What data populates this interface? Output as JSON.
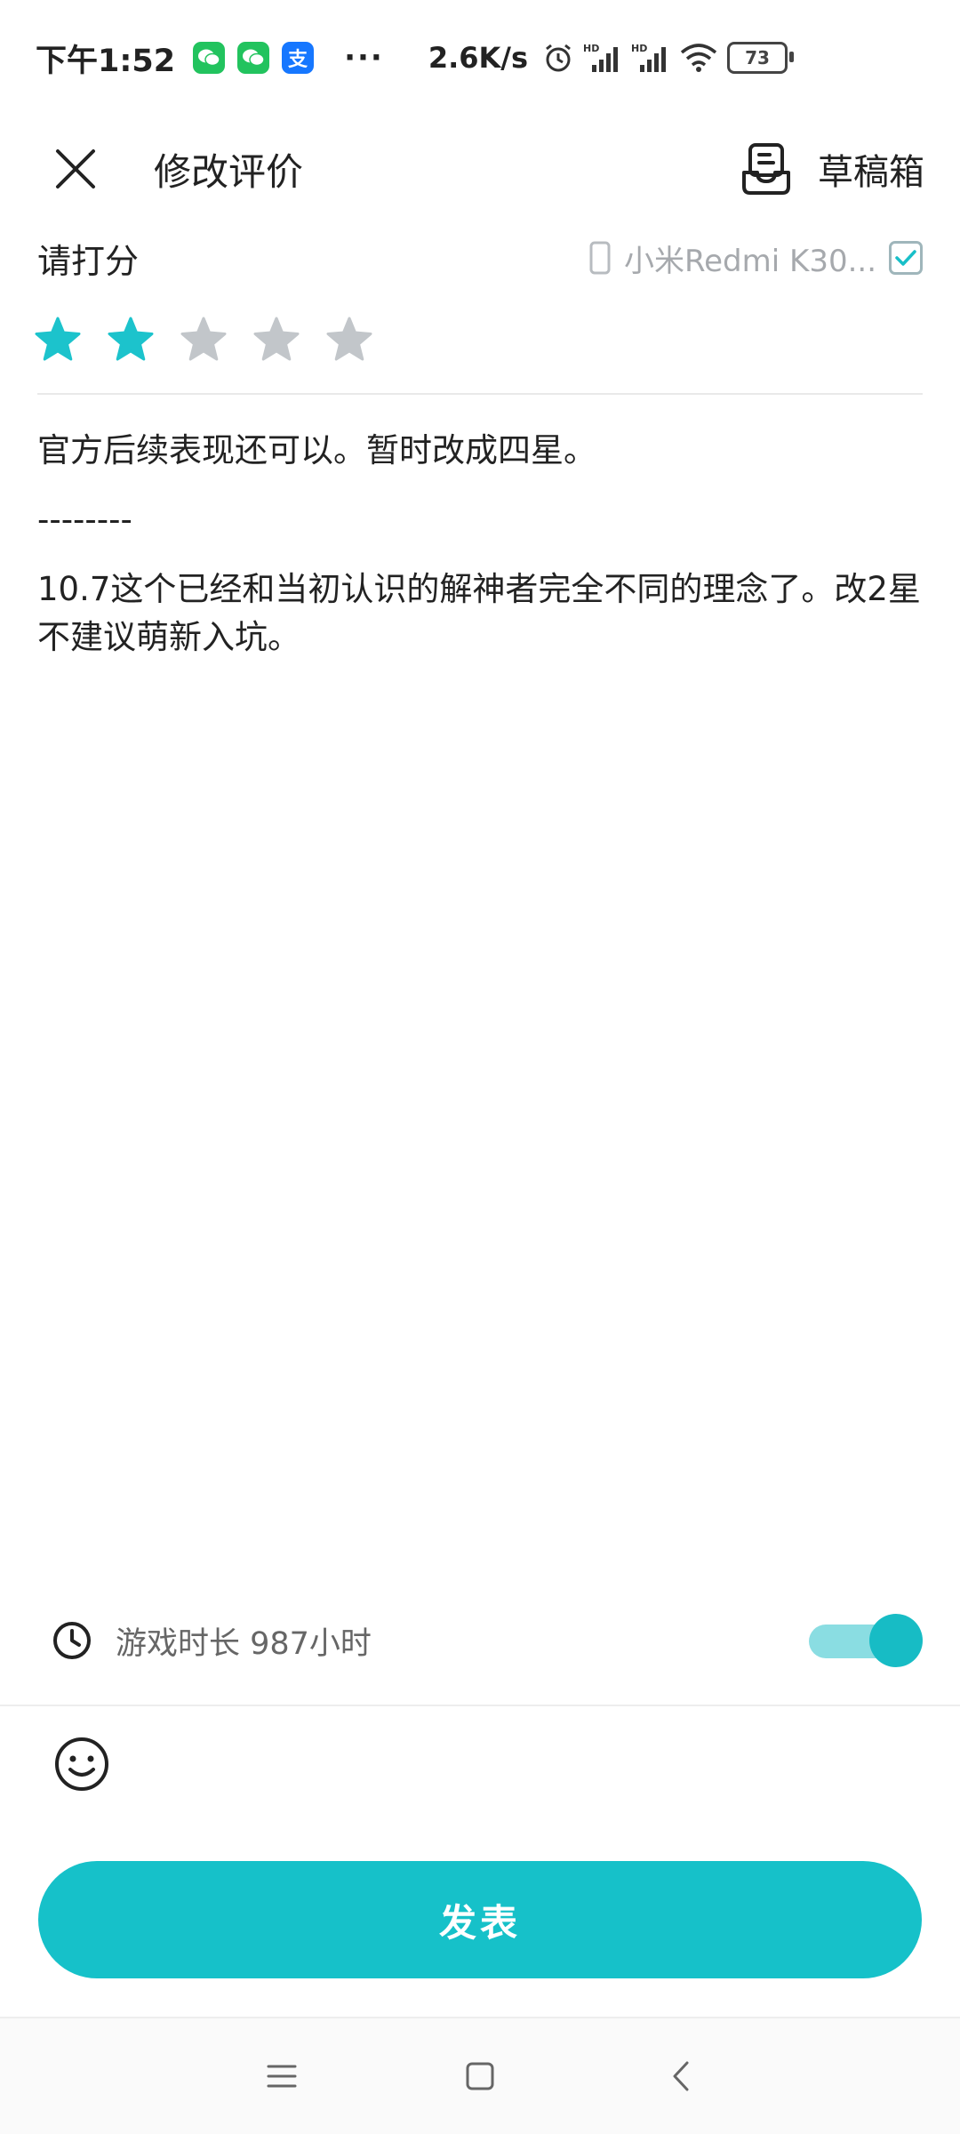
{
  "status_bar": {
    "time": "下午1:52",
    "app_icons": [
      "wechat-icon",
      "wechat-icon",
      "alipay-icon"
    ],
    "alipay_glyph": "支",
    "more_dots": "···",
    "net_speed": "2.6K/s",
    "battery_level": "73"
  },
  "header": {
    "title": "修改评价",
    "draft_label": "草稿箱"
  },
  "rating": {
    "label": "请打分",
    "device_name": "小米Redmi K30...",
    "device_checked": true,
    "score": 2,
    "max_score": 5,
    "active_color": "#1cc3cc",
    "inactive_color": "#c2c6ca"
  },
  "review": {
    "paragraphs": [
      "官方后续表现还可以。暂时改成四星。",
      "--------",
      "10.7这个已经和当初认识的解神者完全不同的理念了。改2星不建议萌新入坑。"
    ]
  },
  "playtime": {
    "label": "游戏时长 987小时",
    "toggle_on": true
  },
  "actions": {
    "publish_label": "发表"
  },
  "colors": {
    "accent": "#16c1c9",
    "toggle_track": "#8adde2"
  }
}
